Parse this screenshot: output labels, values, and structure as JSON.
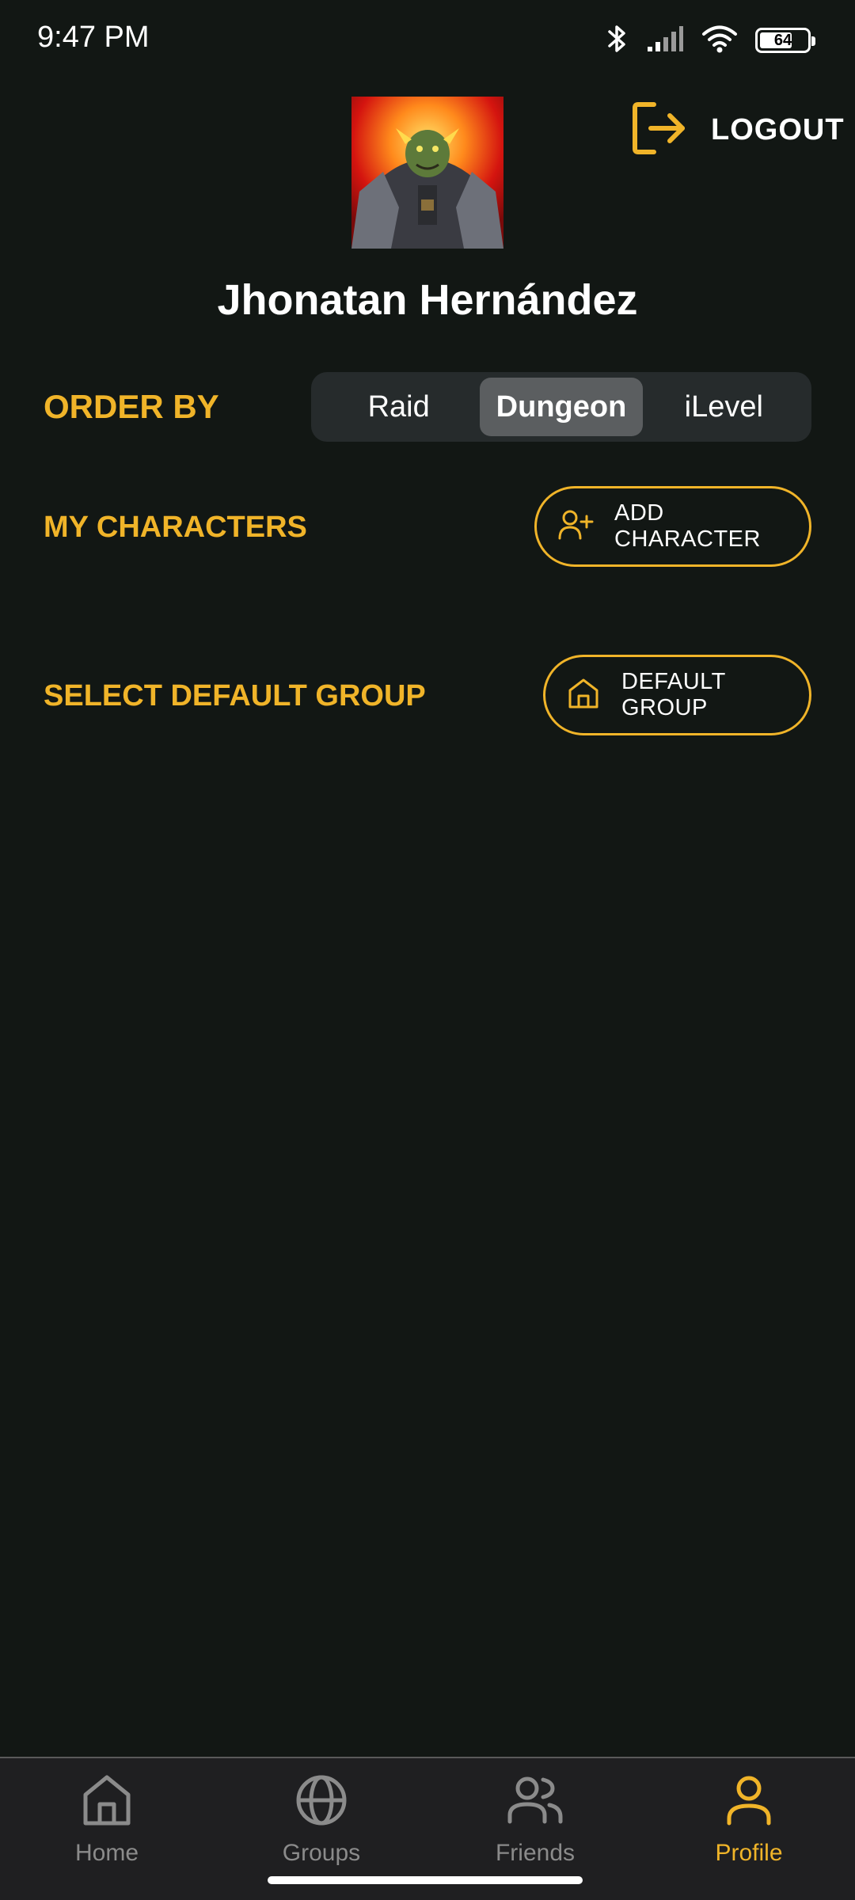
{
  "status_bar": {
    "time": "9:47 PM",
    "battery_level": "64",
    "icons": [
      "bluetooth-icon",
      "signal-icon",
      "wifi-icon",
      "battery-icon"
    ]
  },
  "header": {
    "user_name": "Jhonatan Hernández",
    "logout_label": "LOGOUT",
    "avatar_icon": "character-portrait"
  },
  "order_by": {
    "label": "ORDER BY",
    "options": [
      "Raid",
      "Dungeon",
      "iLevel"
    ],
    "selected": "Dungeon"
  },
  "characters": {
    "label": "MY CHARACTERS",
    "add_button_label": "ADD CHARACTER",
    "add_button_icon": "add-user-icon"
  },
  "default_group": {
    "label": "SELECT DEFAULT GROUP",
    "button_label": "DEFAULT GROUP",
    "button_icon": "home-icon"
  },
  "bottom_nav": {
    "items": [
      {
        "label": "Home",
        "icon": "home-icon"
      },
      {
        "label": "Groups",
        "icon": "globe-icon"
      },
      {
        "label": "Friends",
        "icon": "users-icon"
      },
      {
        "label": "Profile",
        "icon": "user-icon"
      }
    ],
    "active": "Profile"
  },
  "colors": {
    "background": "#121714",
    "accent": "#f0b429",
    "segment_bg": "#262b2c",
    "segment_active": "#5b5e60",
    "nav_bg": "#1f1f21",
    "nav_inactive": "#8b8b8b"
  }
}
